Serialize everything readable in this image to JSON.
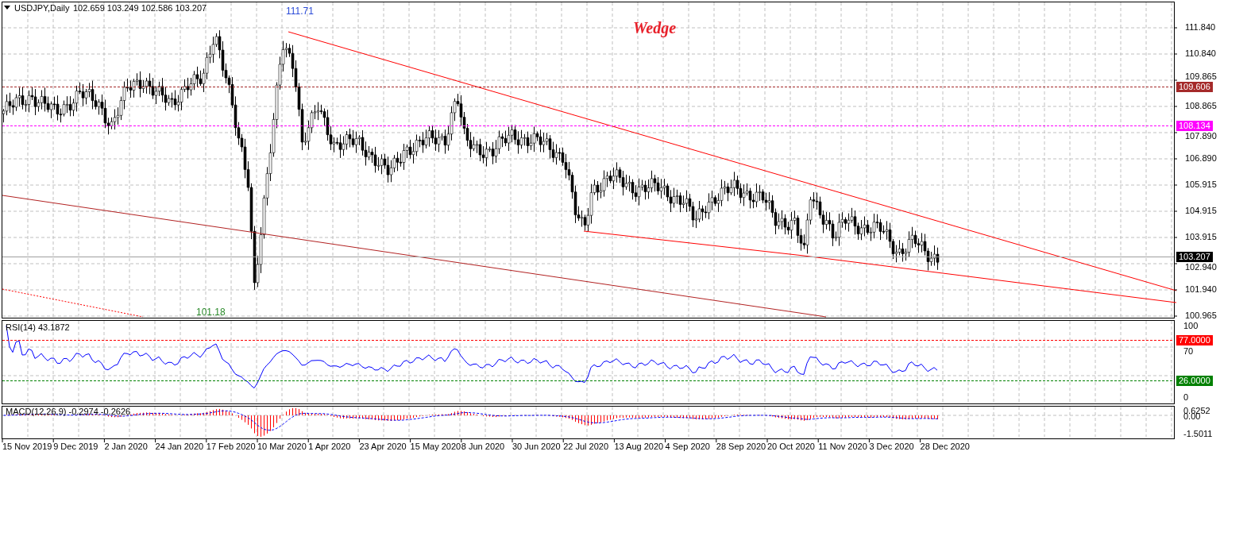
{
  "header": {
    "symbol": "USDJPY,Daily",
    "ohlc": "102.659 103.249 102.586 103.207"
  },
  "annotations": [
    {
      "kind": "high",
      "text": "111.71"
    },
    {
      "kind": "title",
      "text": "Wedge"
    },
    {
      "kind": "low",
      "text": "101.18"
    }
  ],
  "price_axis": {
    "ticks": [
      "111.840",
      "110.840",
      "109.865",
      "108.865",
      "107.890",
      "106.890",
      "105.915",
      "104.915",
      "103.915",
      "102.940",
      "101.940",
      "100.965"
    ],
    "markers": [
      {
        "text": "109.606",
        "color": "#a52a2a"
      },
      {
        "text": "108.134",
        "color": "#ff00ff"
      },
      {
        "text": "103.207",
        "color": "#000000"
      }
    ]
  },
  "rsi": {
    "label": "RSI(14) 43.1872",
    "ticks": [
      "100",
      "70",
      "0"
    ],
    "markers": [
      {
        "text": "77.0000",
        "color": "#ff0000"
      },
      {
        "text": "26.0000",
        "color": "#008000"
      }
    ]
  },
  "macd": {
    "label": "MACD(12,26,9) -0.2974 -0.2626",
    "ticks": [
      "0.6252",
      "0.00",
      "-1.5011"
    ]
  },
  "time_axis": [
    "15 Nov 2019",
    "9 Dec 2019",
    "2 Jan 2020",
    "24 Jan 2020",
    "17 Feb 2020",
    "10 Mar 2020",
    "1 Apr 2020",
    "23 Apr 2020",
    "15 May 2020",
    "8 Jun 2020",
    "30 Jun 2020",
    "22 Jul 2020",
    "13 Aug 2020",
    "4 Sep 2020",
    "28 Sep 2020",
    "20 Oct 2020",
    "11 Nov 2020",
    "3 Dec 2020",
    "28 Dec 2020"
  ]
}
